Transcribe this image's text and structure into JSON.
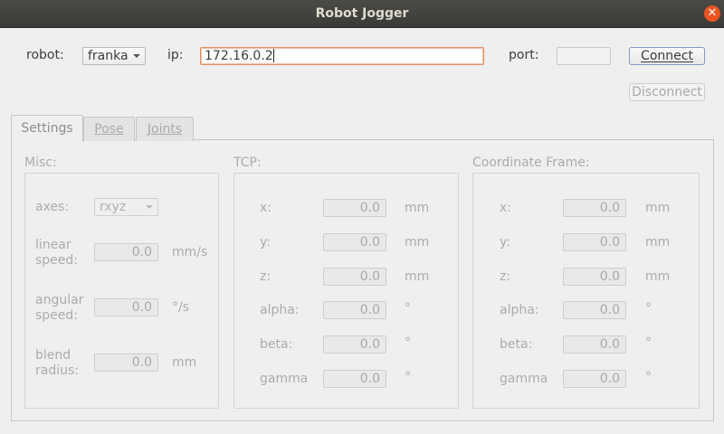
{
  "window": {
    "title": "Robot Jogger"
  },
  "connection": {
    "robot_label": "robot:",
    "robot_value": "franka",
    "ip_label": "ip:",
    "ip_value": "172.16.0.2",
    "port_label": "port:",
    "port_value": "",
    "connect_label": "Connect",
    "disconnect_label": "Disconnect"
  },
  "tabs": [
    {
      "label": "Settings"
    },
    {
      "label": "Pose"
    },
    {
      "label": "Joints"
    }
  ],
  "misc": {
    "title": "Misc:",
    "axes_label": "axes:",
    "axes_value": "rxyz",
    "linear_label_1": "linear",
    "linear_label_2": "speed:",
    "linear_value": "0.0",
    "linear_unit": "mm/s",
    "angular_label_1": "angular",
    "angular_label_2": "speed:",
    "angular_value": "0.0",
    "angular_unit": "°/s",
    "blend_label_1": "blend",
    "blend_label_2": "radius:",
    "blend_value": "0.0",
    "blend_unit": "mm"
  },
  "tcp": {
    "title": "TCP:",
    "rows": [
      {
        "label": "x:",
        "value": "0.0",
        "unit": "mm"
      },
      {
        "label": "y:",
        "value": "0.0",
        "unit": "mm"
      },
      {
        "label": "z:",
        "value": "0.0",
        "unit": "mm"
      },
      {
        "label": "alpha:",
        "value": "0.0",
        "unit": "°"
      },
      {
        "label": "beta:",
        "value": "0.0",
        "unit": "°"
      },
      {
        "label": "gamma",
        "value": "0.0",
        "unit": "°"
      }
    ]
  },
  "frame": {
    "title": "Coordinate Frame:",
    "rows": [
      {
        "label": "x:",
        "value": "0.0",
        "unit": "mm"
      },
      {
        "label": "y:",
        "value": "0.0",
        "unit": "mm"
      },
      {
        "label": "z:",
        "value": "0.0",
        "unit": "mm"
      },
      {
        "label": "alpha:",
        "value": "0.0",
        "unit": "°"
      },
      {
        "label": "beta:",
        "value": "0.0",
        "unit": "°"
      },
      {
        "label": "gamma",
        "value": "0.0",
        "unit": "°"
      }
    ]
  },
  "colors": {
    "accent": "#e95420",
    "titlebar": "#3c3b37",
    "background": "#efefef"
  }
}
